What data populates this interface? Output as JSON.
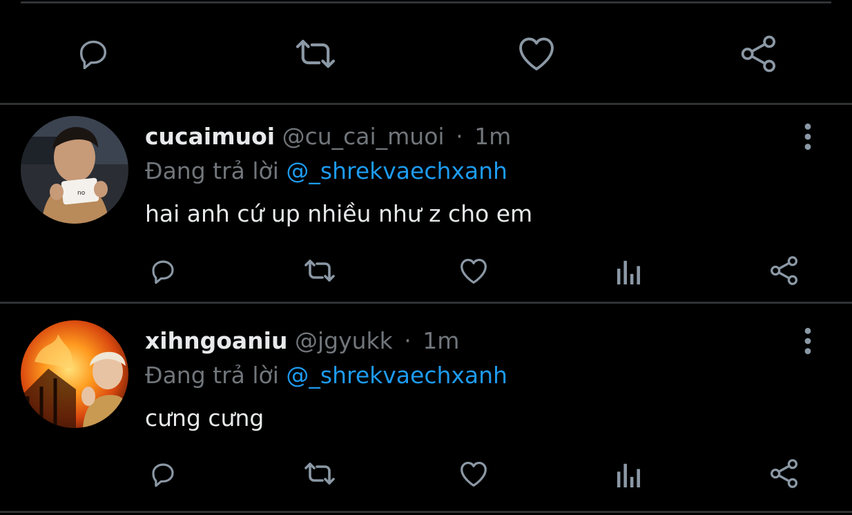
{
  "colors": {
    "background": "#000000",
    "text": "#e7e9ea",
    "muted": "#71767b",
    "accent": "#1d9bf0",
    "divider": "#2f3336"
  },
  "main_tweet_actions": {
    "icons": [
      "reply-icon",
      "retweet-icon",
      "like-icon",
      "share-icon"
    ]
  },
  "replies": [
    {
      "display_name": "cucaimuoi",
      "handle": "@cu_cai_muoi",
      "separator": "·",
      "time": "1m",
      "replying_prefix": "Đang trả lời",
      "replying_to": "@_shrekvaechxanh",
      "text": "hai anh cứ up nhiều như z cho em",
      "actions": [
        "reply-icon",
        "retweet-icon",
        "like-icon",
        "analytics-icon",
        "share-icon"
      ]
    },
    {
      "display_name": "xihngoaniu",
      "handle": "@jgyukk",
      "separator": "·",
      "time": "1m",
      "replying_prefix": "Đang trả lời",
      "replying_to": "@_shrekvaechxanh",
      "text": "cưng cưng",
      "actions": [
        "reply-icon",
        "retweet-icon",
        "like-icon",
        "analytics-icon",
        "share-icon"
      ]
    }
  ]
}
